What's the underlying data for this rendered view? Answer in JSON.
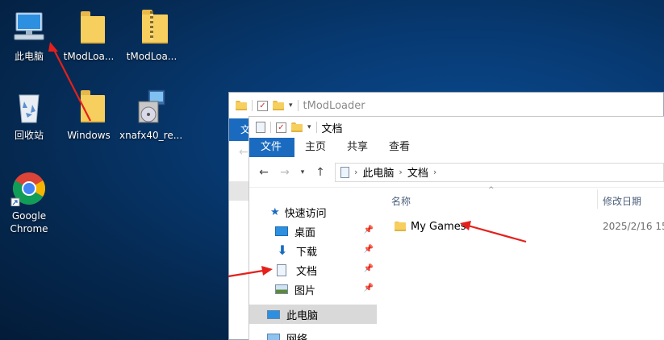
{
  "desktop": {
    "icons": [
      {
        "label": "此电脑",
        "icon": "computer-icon"
      },
      {
        "label": "tModLoa...",
        "icon": "folder-icon"
      },
      {
        "label": "tModLoa...",
        "icon": "zip-folder-icon"
      },
      {
        "label": "回收站",
        "icon": "recycle-bin-icon"
      },
      {
        "label": "Windows",
        "icon": "folder-icon"
      },
      {
        "label": "xnafx40_re...",
        "icon": "installer-icon"
      },
      {
        "label": "Google\nChrome",
        "icon": "chrome-icon"
      }
    ]
  },
  "back_window": {
    "title": "tModLoader",
    "ribbon_file_tab": "文"
  },
  "explorer": {
    "title": "文档",
    "ribbon_tabs": [
      "文件",
      "主页",
      "共享",
      "查看"
    ],
    "address": {
      "segments": [
        "此电脑",
        "文档"
      ]
    },
    "nav": {
      "quick_access": "快速访问",
      "pinned": [
        "桌面",
        "下载",
        "文档",
        "图片"
      ],
      "this_pc": "此电脑",
      "network": "网络"
    },
    "columns": {
      "name": "名称",
      "modified": "修改日期"
    },
    "files": [
      {
        "name": "My Games",
        "modified": "2025/2/16 15"
      }
    ]
  },
  "colors": {
    "accent": "#1a6bbf",
    "arrow": "#e4201b",
    "folder": "#f6cf5e"
  }
}
